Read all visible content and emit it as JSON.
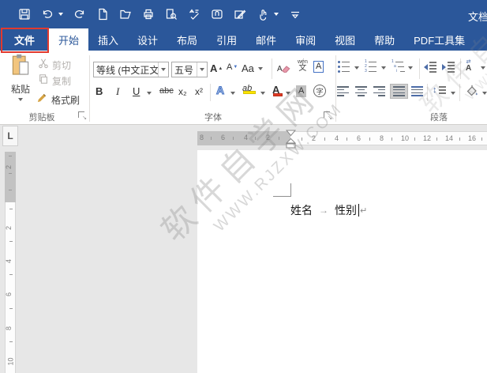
{
  "titlebar": {
    "document_title": "文档"
  },
  "qat_icons": [
    "save",
    "undo",
    "redo",
    "new-document",
    "open",
    "print",
    "print-preview",
    "spelling-check",
    "attachment",
    "edit",
    "touch-mode",
    "customize"
  ],
  "tabs": [
    {
      "label": "文件",
      "state": "file"
    },
    {
      "label": "开始",
      "state": "selected"
    },
    {
      "label": "插入",
      "state": "normal"
    },
    {
      "label": "设计",
      "state": "normal"
    },
    {
      "label": "布局",
      "state": "normal"
    },
    {
      "label": "引用",
      "state": "normal"
    },
    {
      "label": "邮件",
      "state": "normal"
    },
    {
      "label": "审阅",
      "state": "normal"
    },
    {
      "label": "视图",
      "state": "normal"
    },
    {
      "label": "帮助",
      "state": "normal"
    },
    {
      "label": "PDF工具集",
      "state": "normal"
    }
  ],
  "ribbon": {
    "clipboard": {
      "group": "剪贴板",
      "paste": "粘贴",
      "cut": "剪切",
      "copy": "复制",
      "format_painter": "格式刷"
    },
    "font": {
      "group": "字体",
      "name": "等线 (中文正文",
      "size": "五号",
      "grow": "A",
      "shrink": "A",
      "case": "Aa",
      "bold": "B",
      "italic": "I",
      "underline": "U",
      "strikethrough": "abc",
      "subscript": "x₂",
      "superscript": "x²",
      "effects": "A",
      "phonetic_top": "wén",
      "phonetic_bottom": "文",
      "char_border": "A",
      "highlight": "ab",
      "font_color": "A",
      "char_shading": "A",
      "enclose": "字",
      "clear_format": "A"
    },
    "paragraph": {
      "group": "段落",
      "asian_layout": "A",
      "asian_arrows": "⇄",
      "spacing_glyph": "↕"
    }
  },
  "ruler": {
    "tab_selector": "L",
    "h_margin_numbers": [
      "8",
      "6",
      "4",
      "2"
    ],
    "h_numbers": [
      "2",
      "4",
      "6",
      "8",
      "10",
      "12",
      "14",
      "16"
    ],
    "v_margin_numbers": [
      "2"
    ],
    "v_numbers": [
      "2",
      "4",
      "6",
      "8",
      "10"
    ]
  },
  "document": {
    "name_label": "姓名",
    "tab_arrow": "→",
    "gender_label": "性别",
    "para_mark": "↵"
  },
  "watermark": {
    "site_name": "软件自学网",
    "site_url": "WWW.RJZXW.COM"
  },
  "colors": {
    "title_blue": "#2b579a",
    "annotation_red": "#e23a2e",
    "highlight_yellow": "#ffe400",
    "font_color_red": "#e03a23"
  }
}
